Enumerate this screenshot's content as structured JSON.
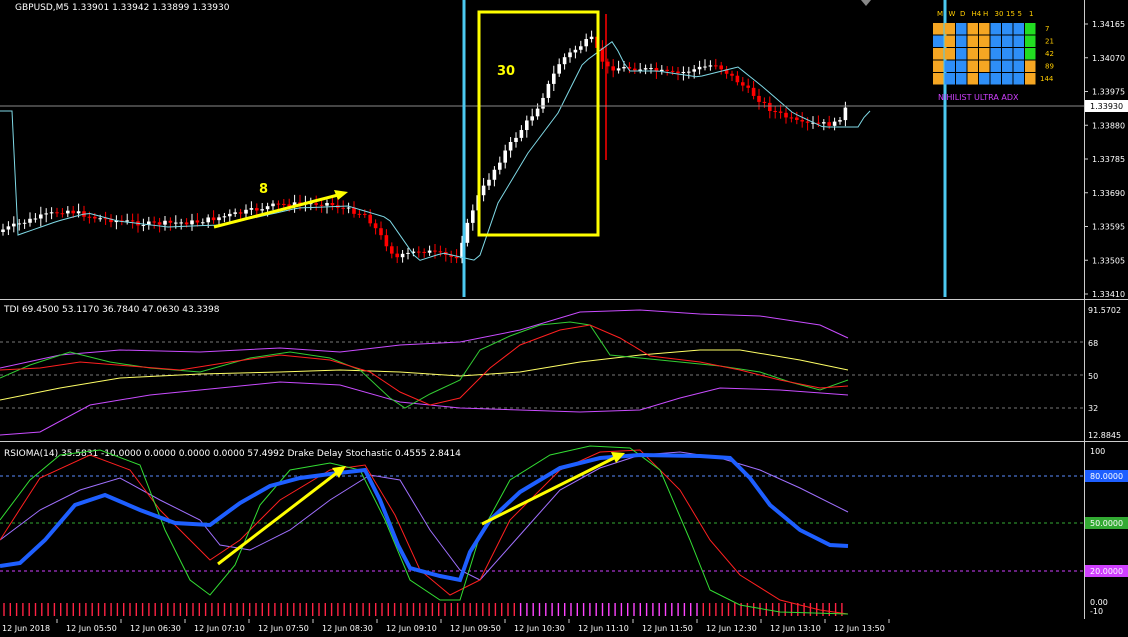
{
  "header": {
    "symbol_line": "GBPUSD,M5  1.33901 1.33942 1.33899 1.33930"
  },
  "colors": {
    "background": "#000000",
    "bull_candle": "#ffffff",
    "bear_candle": "#ff0000",
    "ma_line": "#7fd9e6",
    "annotation": "#ffff00",
    "vertical_marker": "#4cc9f0",
    "tdi_upper": "#c94cff",
    "tdi_lower": "#c94cff",
    "tdi_mid": "#ffff66",
    "tdi_fast": "#33cc33",
    "tdi_slow": "#ff2020",
    "rsioma_main": "#1e5fff",
    "stoch_green": "#33dd33",
    "stoch_red": "#ff2020",
    "stoch_violet": "#a070ff"
  },
  "main_chart": {
    "price_labels": [
      "1.34165",
      "1.34070",
      "1.33975",
      "1.33880",
      "1.33785",
      "1.33690",
      "1.33595",
      "1.33505",
      "1.33410"
    ],
    "current_price": "1.33930",
    "annotation_8": "8",
    "annotation_30": "30",
    "adx_panel": {
      "headers": [
        "M",
        "W",
        "D",
        "H4",
        "H",
        "30",
        "15",
        "5",
        "1"
      ],
      "periods": [
        "7",
        "21",
        "42",
        "89",
        "144"
      ],
      "title": "NIHILIST ULTRA ADX"
    }
  },
  "tdi_panel": {
    "label": "TDI 69.4500 53.1170 36.7840 47.0630 43.3398",
    "scale_labels": [
      "91.5702",
      "68",
      "50",
      "32",
      "12.8845"
    ]
  },
  "rsioma_panel": {
    "label": "RSIOMA(14) 35.5831 -10.0000 0.0000 0.0000 0.0000 57.4992  Drake Delay Stochastic 0.4555 2.8414",
    "scale_labels": [
      "100",
      "80.0000",
      "50.0000",
      "20.0000",
      "0.00",
      "-10"
    ]
  },
  "time_axis": [
    "12 Jun 2018",
    "12 Jun 05:50",
    "12 Jun 06:30",
    "12 Jun 07:10",
    "12 Jun 07:50",
    "12 Jun 08:30",
    "12 Jun 09:10",
    "12 Jun 09:50",
    "12 Jun 10:30",
    "12 Jun 11:10",
    "12 Jun 11:50",
    "12 Jun 12:30",
    "12 Jun 13:10",
    "12 Jun 13:50"
  ]
}
